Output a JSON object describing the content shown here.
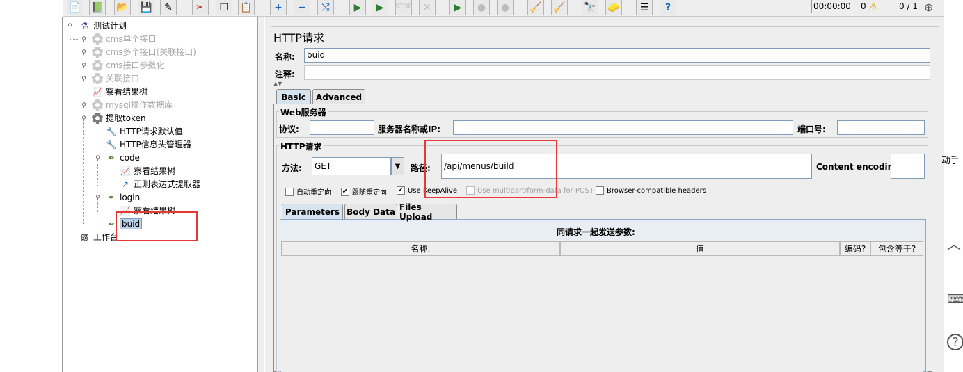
{
  "toolbar": {
    "timer": "00:00:00",
    "warning_count": "0",
    "thread_ratio": "0 / 1"
  },
  "tree": {
    "root": "测试计划",
    "items": [
      {
        "label": "cms单个接口",
        "disabled": true
      },
      {
        "label": "cms多个接口(关联接口)",
        "disabled": true
      },
      {
        "label": "cms接口参数化",
        "disabled": true
      },
      {
        "label": "关联接口",
        "disabled": true
      },
      {
        "label": "察看结果树",
        "disabled": false
      },
      {
        "label": "mysql操作数据库",
        "disabled": true
      },
      {
        "label": "提取token",
        "disabled": false
      }
    ],
    "token_children": [
      {
        "label": "HTTP请求默认值"
      },
      {
        "label": "HTTP信息头管理器"
      },
      {
        "label": "code"
      },
      {
        "label": "察看结果树"
      },
      {
        "label": "正则表达式提取器"
      },
      {
        "label": "login"
      },
      {
        "label": "察看结果树"
      },
      {
        "label": "buid"
      }
    ],
    "workbench": "工作台"
  },
  "editor": {
    "title": "HTTP请求",
    "name_label": "名称:",
    "name_value": "buid",
    "comment_label": "注释:",
    "comment_value": "",
    "tabs": [
      "Basic",
      "Advanced"
    ],
    "web_server": {
      "group_title": "Web服务器",
      "protocol_label": "协议:",
      "protocol_value": "",
      "server_label": "服务器名称或IP:",
      "server_value": "",
      "port_label": "端口号:",
      "port_value": ""
    },
    "http_request": {
      "group_title": "HTTP请求",
      "method_label": "方法:",
      "method_value": "GET",
      "path_label": "路径:",
      "path_value": "/api/menus/build",
      "encoding_label": "Content encoding:",
      "encoding_value": ""
    },
    "checkboxes": [
      {
        "label": "自动重定向",
        "checked": false,
        "disabled": false
      },
      {
        "label": "跟随重定向",
        "checked": true,
        "disabled": false
      },
      {
        "label": "Use KeepAlive",
        "checked": true,
        "disabled": false
      },
      {
        "label": "Use multipart/form-data for POST",
        "checked": false,
        "disabled": true
      },
      {
        "label": "Browser-compatible headers",
        "checked": false,
        "disabled": false
      }
    ],
    "param_tabs": [
      "Parameters",
      "Body Data",
      "Files Upload"
    ],
    "params_caption": "同请求一起发送参数:",
    "param_columns": [
      "名称:",
      "值",
      "编码?",
      "包含等于?"
    ]
  },
  "side_float": {
    "assistant_text": "动手"
  }
}
